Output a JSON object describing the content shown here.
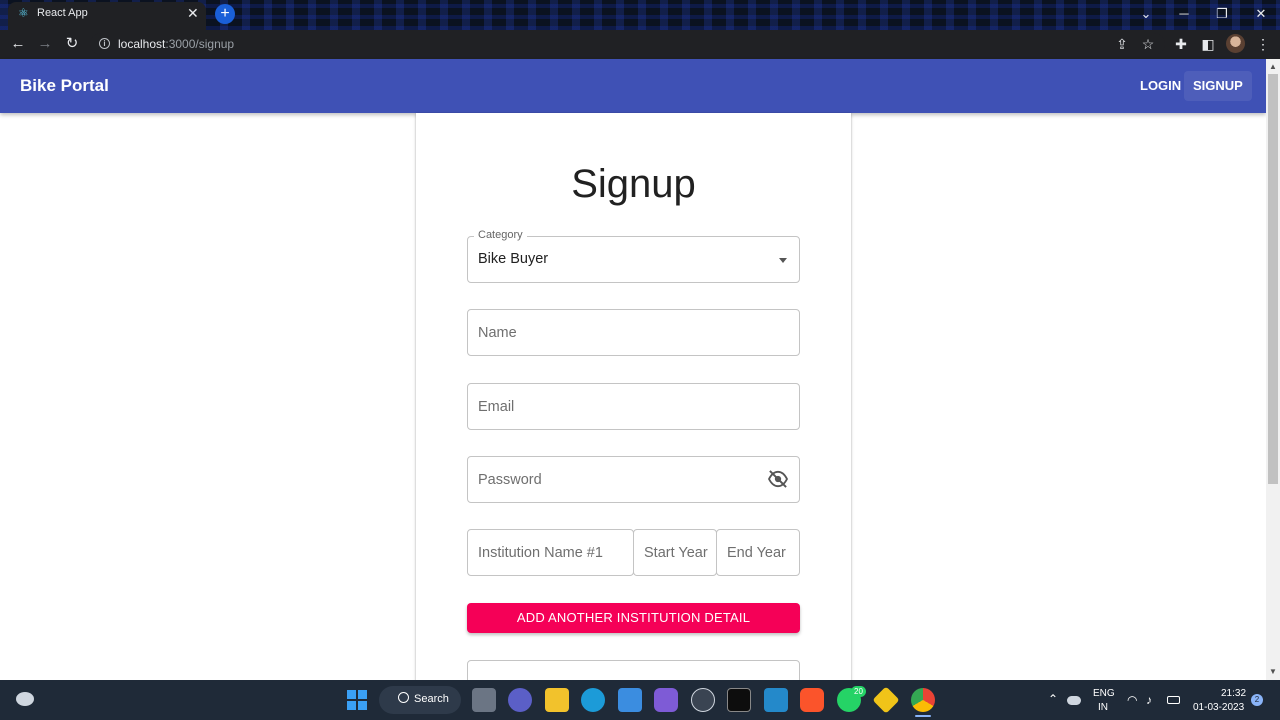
{
  "browser": {
    "tab_title": "React App",
    "tab_close": "✕",
    "new_tab": "+",
    "url_host": "localhost",
    "url_path": ":3000/signup",
    "window_controls": [
      "⌄",
      "─",
      "❐",
      "✕"
    ]
  },
  "appbar": {
    "title": "Bike Portal",
    "nav": [
      {
        "label": "LOGIN"
      },
      {
        "label": "SIGNUP"
      }
    ]
  },
  "form": {
    "heading": "Signup",
    "category": {
      "label": "Category",
      "value": "Bike Buyer"
    },
    "name_placeholder": "Name",
    "email_placeholder": "Email",
    "password_placeholder": "Password",
    "institution_placeholder": "Institution Name #1",
    "start_year_placeholder": "Start Year",
    "end_year_placeholder": "End Year",
    "add_button": "ADD ANOTHER INSTITUTION DETAIL"
  },
  "taskbar": {
    "search_label": "Search",
    "language": "ENG",
    "region": "IN",
    "time": "21:32",
    "date": "01-03-2023",
    "whatsapp_badge": "20",
    "notification_count": "2"
  }
}
